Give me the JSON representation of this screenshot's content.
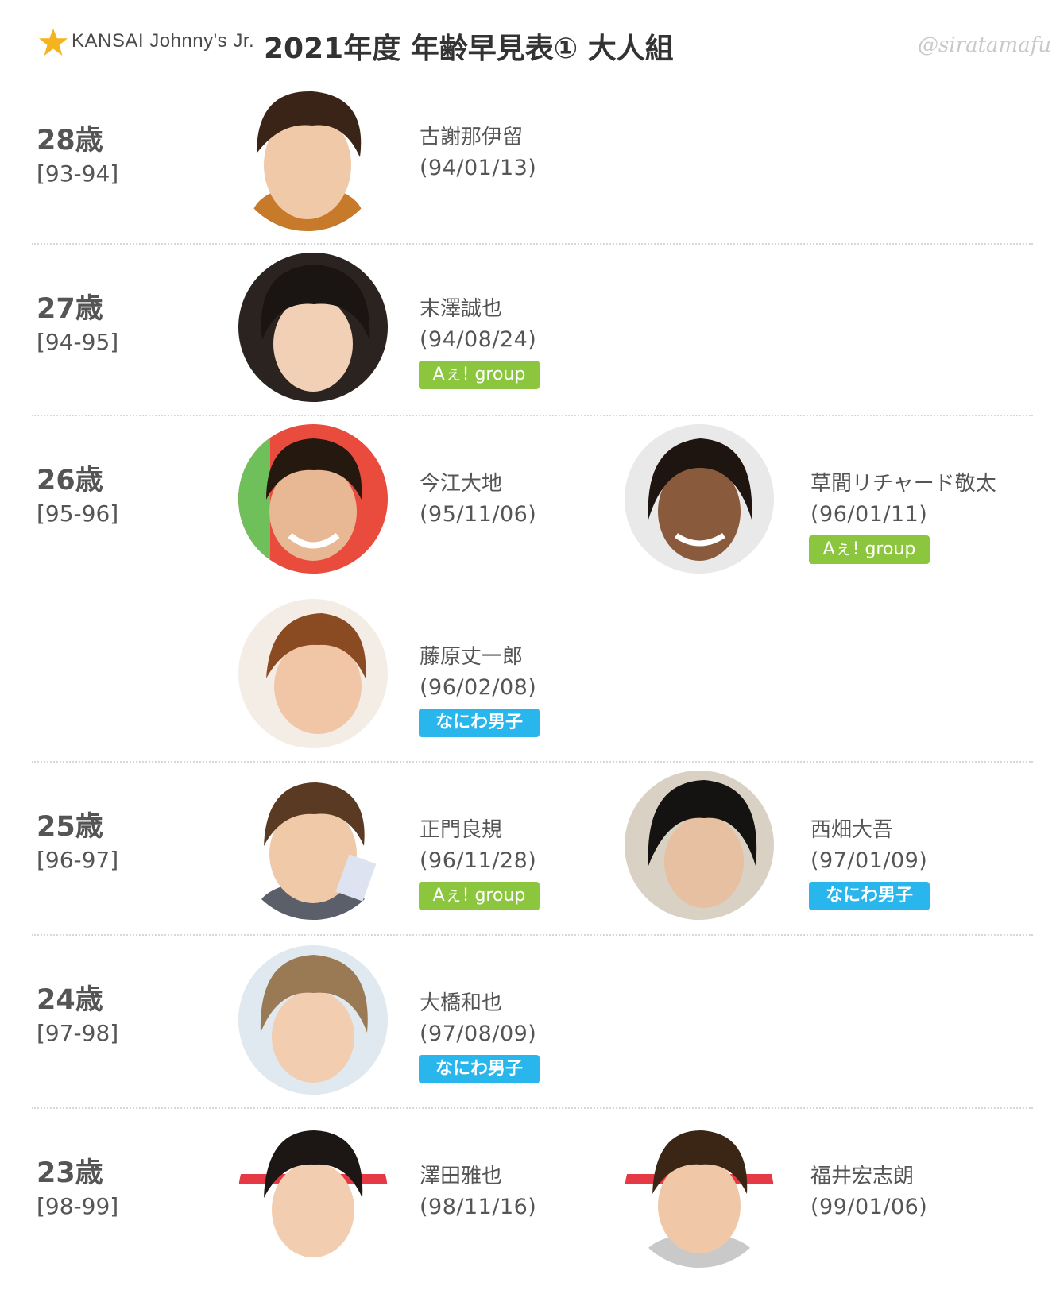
{
  "header": {
    "logo_text": "KANSAI Johnny's Jr.",
    "title": "2021年度 年齢早見表① 大人組",
    "watermark": "@siratamafu"
  },
  "groups": {
    "ae": "Aぇ! group",
    "naniwa": "なにわ男子"
  },
  "colors": {
    "ae_badge": "#8cc63f",
    "naniwa_badge": "#29b6ec",
    "star": "#f5b41e"
  },
  "rows": [
    {
      "age": "28歳",
      "years": "[93-94]",
      "members": [
        {
          "name": "古謝那伊留",
          "birthday": "(94/01/13)",
          "group": ""
        }
      ]
    },
    {
      "age": "27歳",
      "years": "[94-95]",
      "members": [
        {
          "name": "末澤誠也",
          "birthday": "(94/08/24)",
          "group": "Aぇ! group"
        }
      ]
    },
    {
      "age": "26歳",
      "years": "[95-96]",
      "members": [
        {
          "name": "今江大地",
          "birthday": "(95/11/06)",
          "group": ""
        },
        {
          "name": "草間リチャード敬太",
          "birthday": "(96/01/11)",
          "group": "Aぇ! group"
        },
        {
          "name": "藤原丈一郎",
          "birthday": "(96/02/08)",
          "group": "なにわ男子"
        }
      ]
    },
    {
      "age": "25歳",
      "years": "[96-97]",
      "members": [
        {
          "name": "正門良規",
          "birthday": "(96/11/28)",
          "group": "Aぇ! group"
        },
        {
          "name": "西畑大吾",
          "birthday": "(97/01/09)",
          "group": "なにわ男子"
        }
      ]
    },
    {
      "age": "24歳",
      "years": "[97-98]",
      "members": [
        {
          "name": "大橋和也",
          "birthday": "(97/08/09)",
          "group": "なにわ男子"
        }
      ]
    },
    {
      "age": "23歳",
      "years": "[98-99]",
      "members": [
        {
          "name": "澤田雅也",
          "birthday": "(98/11/16)",
          "group": ""
        },
        {
          "name": "福井宏志朗",
          "birthday": "(99/01/06)",
          "group": ""
        }
      ]
    }
  ]
}
